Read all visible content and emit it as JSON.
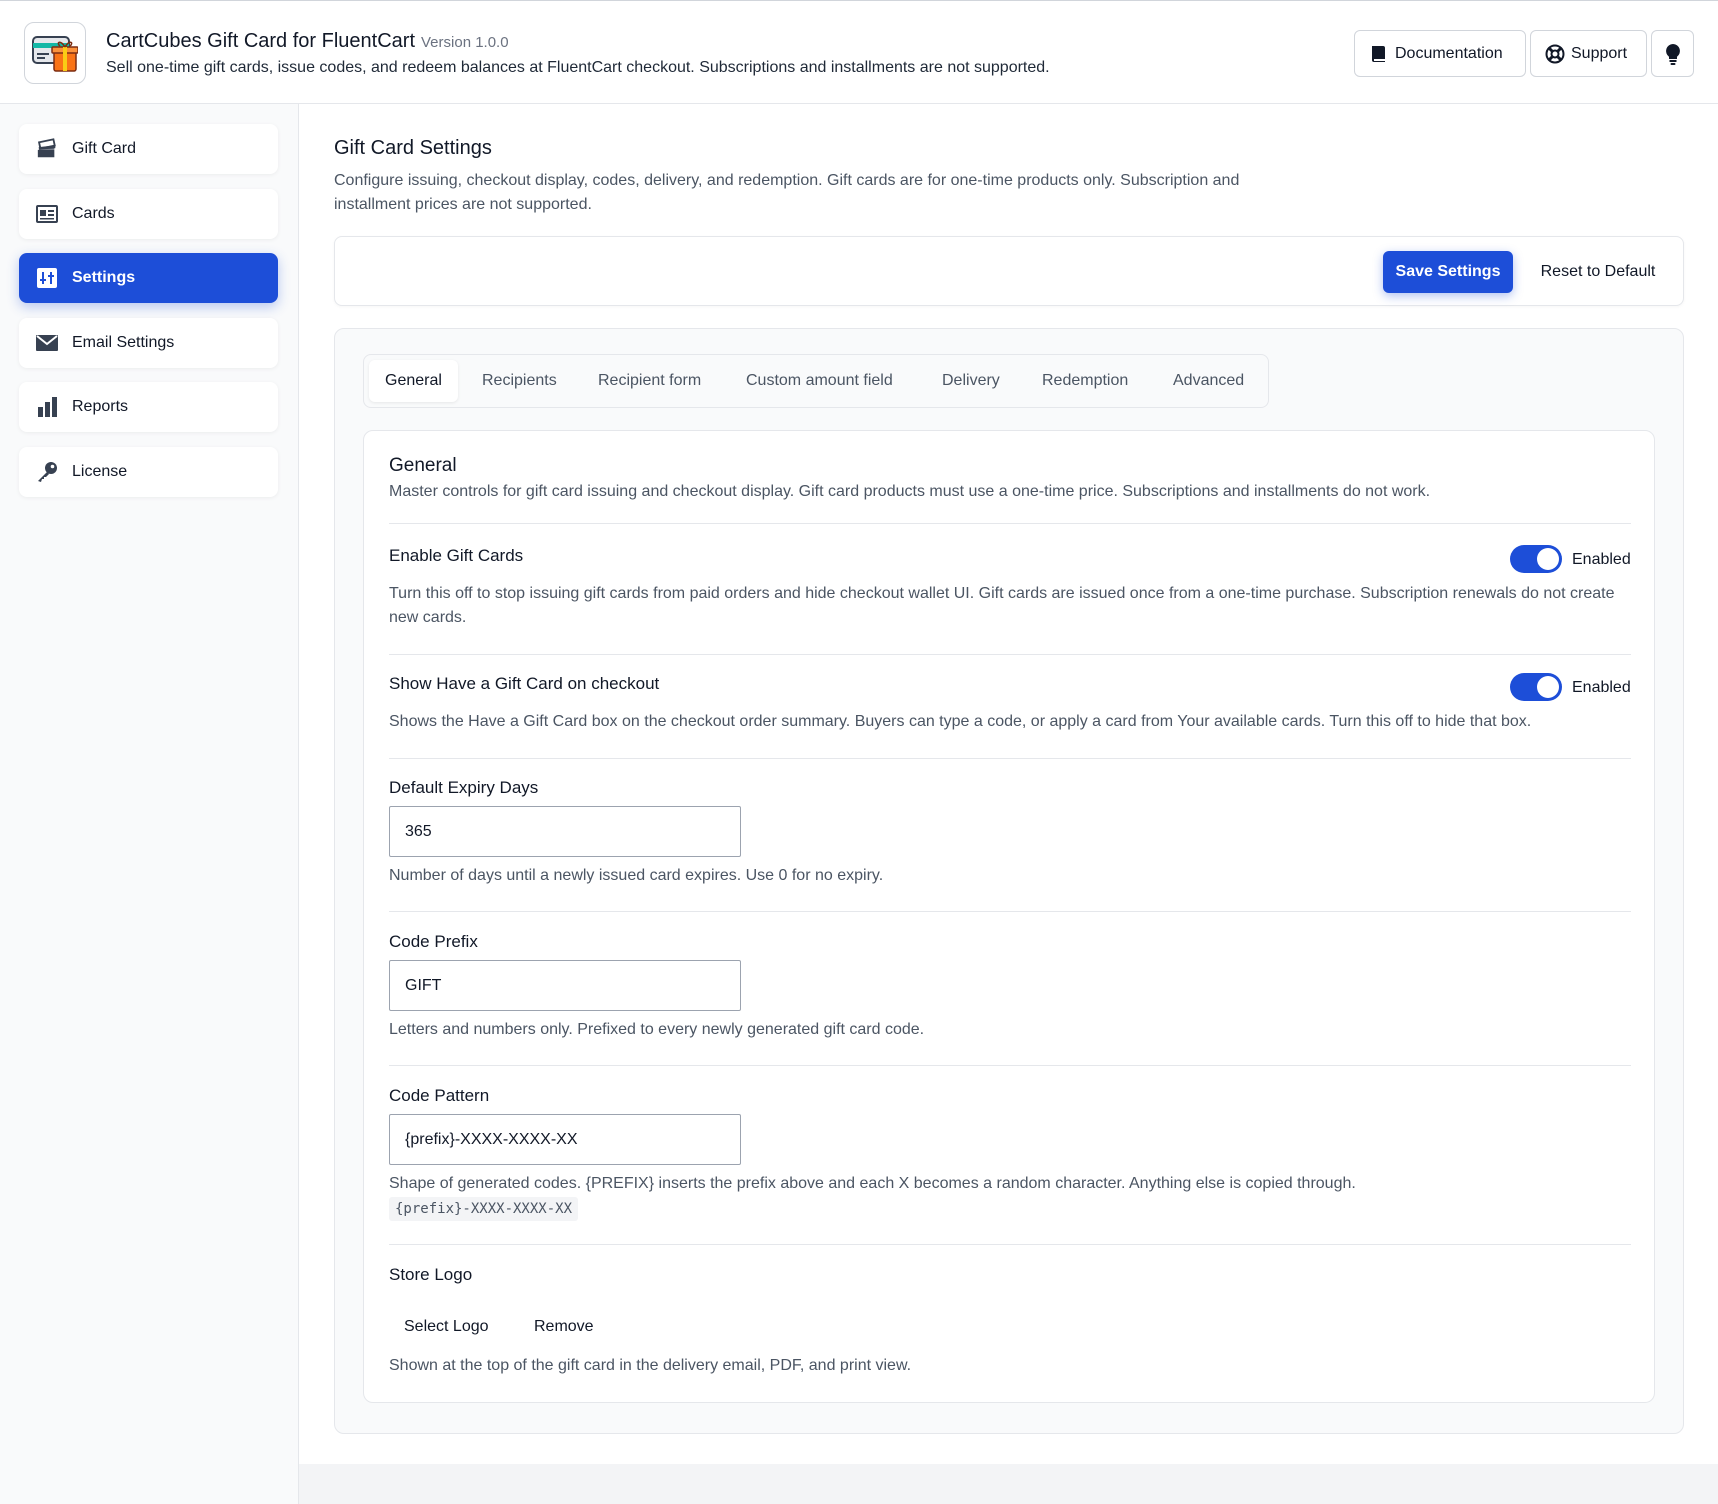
{
  "header": {
    "title": "CartCubes Gift Card for FluentCart",
    "version": "Version 1.0.0",
    "subtitle": "Sell one-time gift cards, issue codes, and redeem balances at FluentCart checkout. Subscriptions and installments are not supported.",
    "documentation_label": "Documentation",
    "support_label": "Support"
  },
  "sidebar": {
    "items": [
      {
        "label": "Gift Card",
        "icon": "gift-card-stack-icon"
      },
      {
        "label": "Cards",
        "icon": "id-card-icon"
      },
      {
        "label": "Settings",
        "icon": "settings-icon",
        "active": true
      },
      {
        "label": "Email Settings",
        "icon": "envelope-icon"
      },
      {
        "label": "Reports",
        "icon": "bar-chart-icon"
      },
      {
        "label": "License",
        "icon": "key-icon"
      }
    ]
  },
  "page": {
    "title": "Gift Card Settings",
    "description": "Configure issuing, checkout display, codes, delivery, and redemption. Gift cards are for one-time products only. Subscription and installment prices are not supported.",
    "save_label": "Save Settings",
    "reset_label": "Reset to Default"
  },
  "tabs": [
    "General",
    "Recipients",
    "Recipient form",
    "Custom amount field",
    "Delivery",
    "Redemption",
    "Advanced"
  ],
  "general": {
    "title": "General",
    "description": "Master controls for gift card issuing and checkout display. Gift card products must use a one-time price. Subscriptions and installments do not work.",
    "enable": {
      "label": "Enable Gift Cards",
      "state": "Enabled",
      "help": "Turn this off to stop issuing gift cards from paid orders and hide checkout wallet UI. Gift cards are issued once from a one-time purchase. Subscription renewals do not create new cards."
    },
    "show_checkout": {
      "label": "Show Have a Gift Card on checkout",
      "state": "Enabled",
      "help": "Shows the Have a Gift Card box on the checkout order summary. Buyers can type a code, or apply a card from Your available cards. Turn this off to hide that box."
    },
    "expiry": {
      "label": "Default Expiry Days",
      "value": "365",
      "help": "Number of days until a newly issued card expires. Use 0 for no expiry."
    },
    "prefix": {
      "label": "Code Prefix",
      "value": "GIFT",
      "help": "Letters and numbers only. Prefixed to every newly generated gift card code."
    },
    "pattern": {
      "label": "Code Pattern",
      "value": "{prefix}-XXXX-XXXX-XX",
      "help": "Shape of generated codes. {PREFIX} inserts the prefix above and each X becomes a random character. Anything else is copied through.",
      "example": "{prefix}-XXXX-XXXX-XX"
    },
    "logo": {
      "label": "Store Logo",
      "select_label": "Select Logo",
      "remove_label": "Remove",
      "help": "Shown at the top of the gift card in the delivery email, PDF, and print view."
    }
  },
  "colors": {
    "accent": "#1d4ed8"
  }
}
